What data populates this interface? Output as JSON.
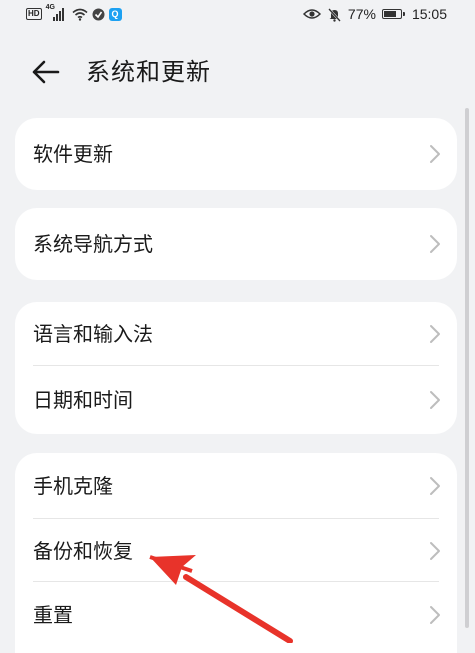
{
  "status_bar": {
    "hd_label": "HD",
    "network_label": "4G",
    "battery_percent": "77%",
    "battery_level": 0.77,
    "time": "15:05",
    "icons": [
      "hd-icon",
      "signal-icon",
      "wifi-icon",
      "vpn-icon",
      "search-app-icon",
      "eye-icon",
      "mute-icon",
      "battery-icon"
    ]
  },
  "header": {
    "back_icon": "arrow-left-icon",
    "title": "系统和更新"
  },
  "groups": [
    {
      "items": [
        {
          "label": "软件更新"
        }
      ]
    },
    {
      "items": [
        {
          "label": "系统导航方式"
        }
      ]
    },
    {
      "items": [
        {
          "label": "语言和输入法"
        },
        {
          "label": "日期和时间"
        }
      ]
    },
    {
      "items": [
        {
          "label": "手机克隆"
        },
        {
          "label": "备份和恢复"
        },
        {
          "label": "重置"
        }
      ]
    }
  ],
  "colors": {
    "background": "#f1f2f4",
    "card": "#ffffff",
    "annotation": "#e8332a",
    "app_badge": "#1da1f2"
  }
}
